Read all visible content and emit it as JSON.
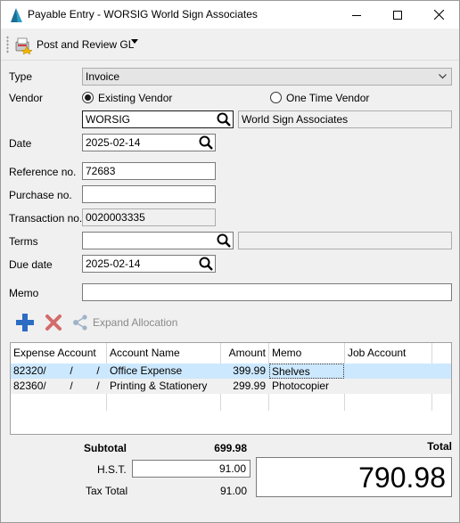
{
  "window": {
    "title": "Payable Entry - WORSIG World Sign Associates"
  },
  "toolbar": {
    "post_label": "Post and Review GL"
  },
  "form": {
    "type_label": "Type",
    "type_value": "Invoice",
    "vendor_label": "Vendor",
    "existing_vendor_label": "Existing Vendor",
    "one_time_vendor_label": "One Time Vendor",
    "vendor_code": "WORSIG",
    "vendor_name": "World Sign Associates",
    "date_label": "Date",
    "date_value": "2025-02-14",
    "reference_label": "Reference no.",
    "reference_value": "72683",
    "purchase_label": "Purchase no.",
    "purchase_value": "",
    "transaction_label": "Transaction no.",
    "transaction_value": "0020003335",
    "terms_label": "Terms",
    "terms_value": "",
    "terms_desc": "",
    "due_label": "Due date",
    "due_value": "2025-02-14",
    "memo_label": "Memo",
    "memo_value": ""
  },
  "actions": {
    "expand_label": "Expand Allocation"
  },
  "grid": {
    "headers": [
      "Expense Account",
      "Account Name",
      "Amount",
      "Memo",
      "Job Account"
    ],
    "rows": [
      {
        "account": "82320/        /        /",
        "name": "Office Expense",
        "amount": "399.99",
        "memo": "Shelves",
        "job": ""
      },
      {
        "account": "82360/        /        /",
        "name": "Printing & Stationery",
        "amount": "299.99",
        "memo": "Photocopier",
        "job": ""
      }
    ]
  },
  "totals": {
    "subtotal_label": "Subtotal",
    "subtotal_value": "699.98",
    "total_label": "Total",
    "hst_label": "H.S.T.",
    "hst_value": "91.00",
    "taxtotal_label": "Tax Total",
    "taxtotal_value": "91.00",
    "total_value": "790.98"
  },
  "colors": {
    "selected_row": "#cce8ff",
    "alt_row": "#f0f0f0",
    "add_icon": "#2b6cc4",
    "delete_icon": "#d46a6a"
  }
}
